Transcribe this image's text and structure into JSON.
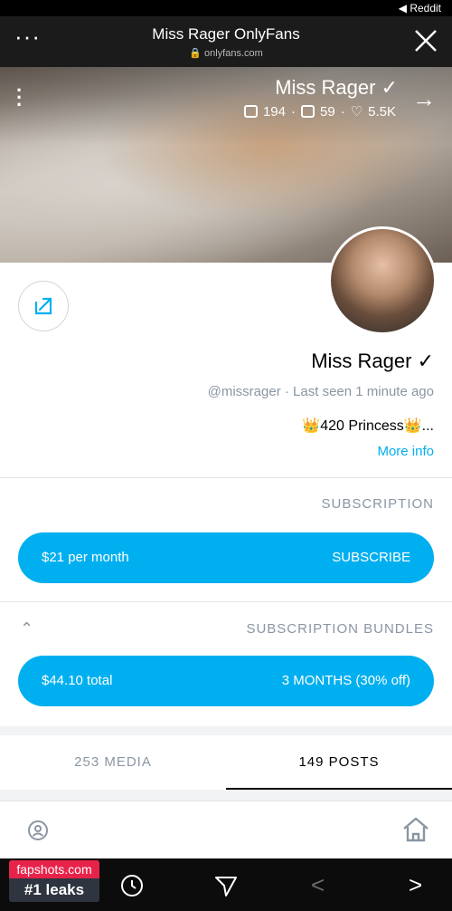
{
  "status_bar": {
    "back_app": "◀ Reddit"
  },
  "browser": {
    "title": "Miss Rager OnlyFans",
    "url": "onlyfans.com",
    "menu_glyph": "···"
  },
  "cover": {
    "name": "Miss Rager",
    "photos": "194",
    "videos": "59",
    "likes": "5.5K"
  },
  "profile": {
    "name": "Miss Rager",
    "handle": "@missrager",
    "last_seen": "Last seen 1 minute ago",
    "bio": "👑420 Princess👑...",
    "more_info": "More info"
  },
  "subscription": {
    "label": "SUBSCRIPTION",
    "button_label": "SUBSCRIBE",
    "price": "$21 per month"
  },
  "bundles": {
    "label": "SUBSCRIPTION BUNDLES",
    "bundle_label": "3 MONTHS (30% off)",
    "bundle_price": "$44.10 total"
  },
  "tabs": {
    "posts": "149 POSTS",
    "media": "253 MEDIA"
  },
  "watermark": {
    "site": "fapshots.com",
    "tagline": "#1 leaks"
  },
  "colors": {
    "accent": "#00aff0",
    "muted": "#8a96a3"
  }
}
